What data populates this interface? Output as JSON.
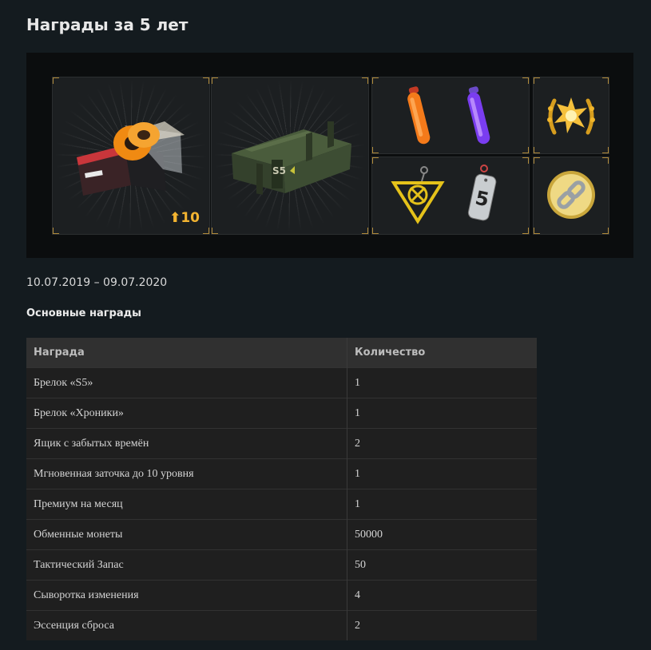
{
  "page": {
    "title": "Награды за 5 лет"
  },
  "banner": {
    "upgrade_badge": "10"
  },
  "period": "10.07.2019 – 09.07.2020",
  "section": {
    "title": "Основные награды"
  },
  "table": {
    "headers": [
      "Награда",
      "Количество"
    ],
    "rows": [
      {
        "name": "Брелок «S5»",
        "qty": "1"
      },
      {
        "name": "Брелок «Хроники»",
        "qty": "1"
      },
      {
        "name": "Ящик с забытых времён",
        "qty": "2"
      },
      {
        "name": "Мгновенная заточка до 10 уровня",
        "qty": "1"
      },
      {
        "name": "Премиум на месяц",
        "qty": "1"
      },
      {
        "name": "Обменные монеты",
        "qty": "50000"
      },
      {
        "name": "Тактический Запас",
        "qty": "50"
      },
      {
        "name": "Сыворотка изменения",
        "qty": "4"
      },
      {
        "name": "Эссенция сброса",
        "qty": "2"
      }
    ]
  },
  "colors": {
    "accent_gold": "#f3b431",
    "frame_gold": "#b08a3a",
    "background": "#141b1f"
  },
  "icons": [
    "instant-upgrade-box-icon",
    "military-crate-icon",
    "orange-serum-icon",
    "purple-serum-icon",
    "premium-emblem-icon",
    "chronicles-keychain-icon",
    "s5-keychain-icon",
    "exchange-coin-icon",
    "upgrade-arrow-icon"
  ]
}
